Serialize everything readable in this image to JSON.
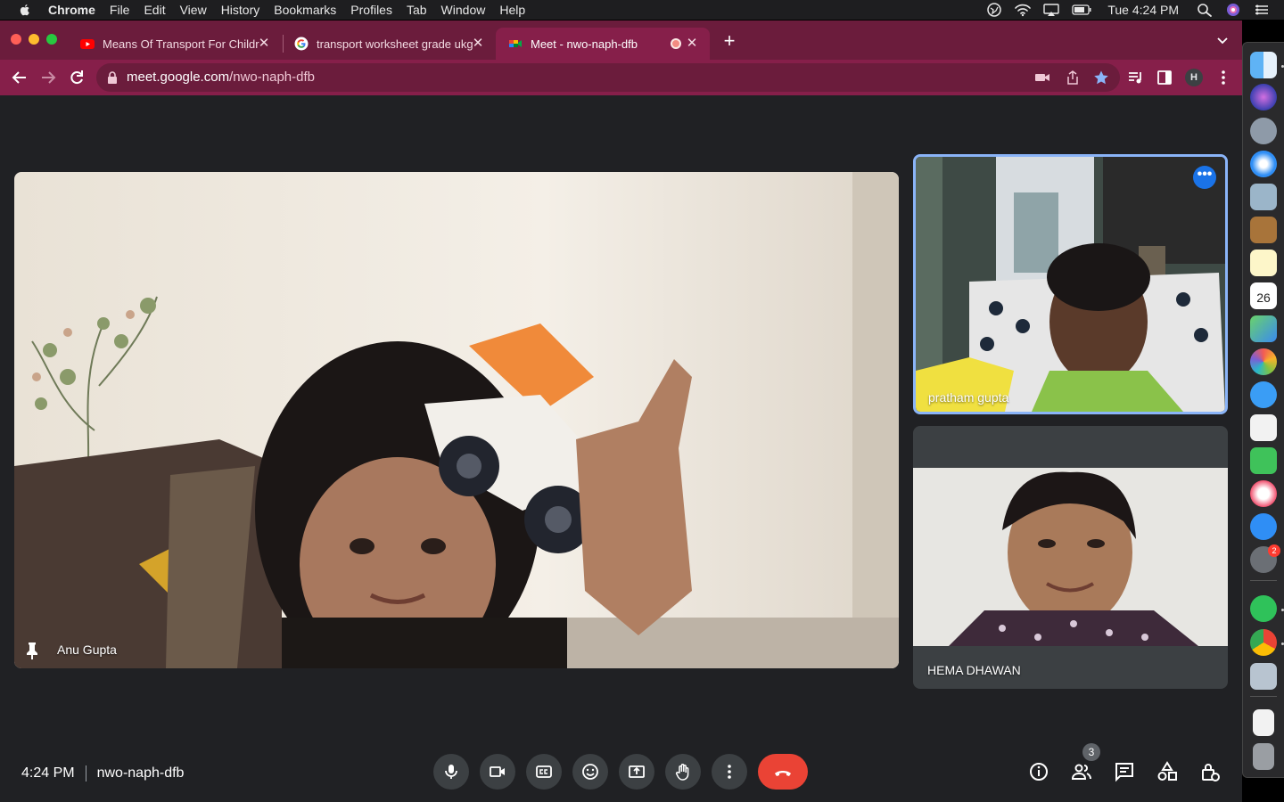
{
  "menubar": {
    "app": "Chrome",
    "items": [
      "File",
      "Edit",
      "View",
      "History",
      "Bookmarks",
      "Profiles",
      "Tab",
      "Window",
      "Help"
    ],
    "clock": "Tue 4:24 PM"
  },
  "tabs": [
    {
      "title": "Means Of Transport For Childr",
      "favicon": "youtube-icon"
    },
    {
      "title": "transport worksheet grade ukg",
      "favicon": "google-icon"
    },
    {
      "title": "Meet - nwo-naph-dfb",
      "favicon": "meet-icon",
      "active": true
    }
  ],
  "omnibox": {
    "host": "meet.google.com",
    "path": "/nwo-naph-dfb"
  },
  "profile_initial": "H",
  "participants": {
    "main": {
      "name": "Anu Gupta",
      "pinned": true
    },
    "side": [
      {
        "name": "pratham gupta",
        "active_speaker": true
      },
      {
        "name": "HEMA DHAWAN"
      }
    ]
  },
  "meeting": {
    "time": "4:24 PM",
    "code": "nwo-naph-dfb",
    "people_count": "3"
  },
  "dock": {
    "calendar_day": "26",
    "settings_badge": "2"
  },
  "colors": {
    "tab_strip": "#6b1c3c",
    "toolbar": "#861f4a",
    "meet_bg": "#202124",
    "end_call": "#ea4335",
    "accent": "#8ab4f8"
  }
}
